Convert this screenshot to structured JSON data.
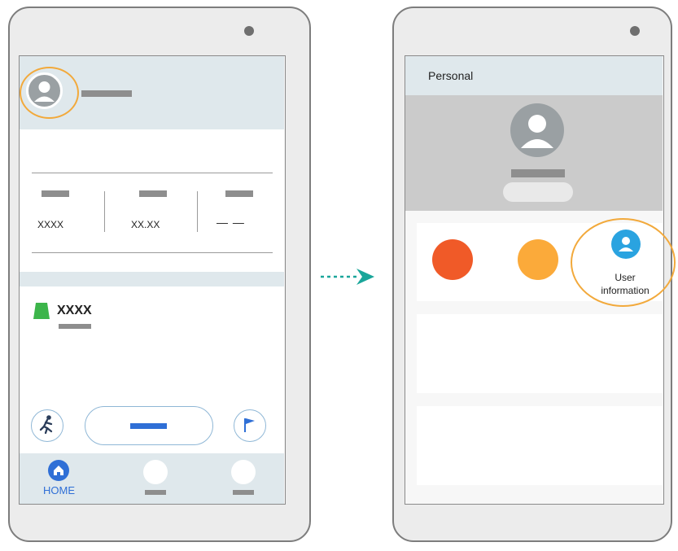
{
  "left_phone": {
    "stats": [
      {
        "value": "XXXX"
      },
      {
        "value": "XX.XX"
      },
      {
        "value": "— —"
      }
    ],
    "item_label": "XXXX",
    "nav": {
      "home_label": "HOME"
    }
  },
  "right_phone": {
    "header_title": "Personal",
    "user_info_label_line1": "User",
    "user_info_label_line2": "information"
  },
  "colors": {
    "highlight_ring": "#f2a93b",
    "teal_arrow": "#1aa69a",
    "accent_blue": "#2f6fd6",
    "red_circle": "#f05a28",
    "orange_circle": "#fbaa3a",
    "user_icon_blue": "#2aa3e0",
    "green_tag": "#3cb54a"
  }
}
